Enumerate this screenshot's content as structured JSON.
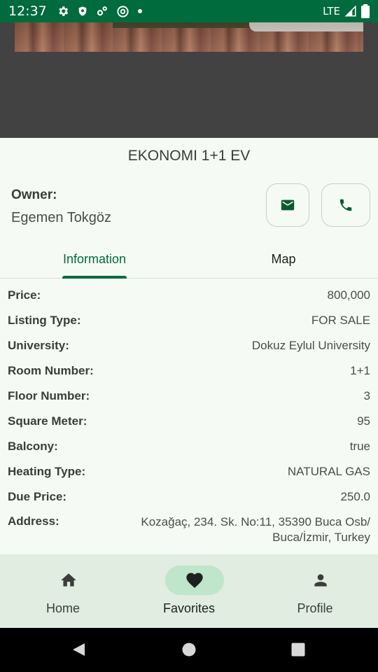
{
  "status_bar": {
    "time": "12:37",
    "network": "LTE"
  },
  "listing": {
    "title": "EKONOMI 1+1 EV",
    "owner_label": "Owner:",
    "owner_name": "Egemen Tokgöz"
  },
  "tabs": [
    {
      "label": "Information"
    },
    {
      "label": "Map"
    }
  ],
  "details": [
    {
      "label": "Price:",
      "value": "800,000"
    },
    {
      "label": "Listing Type:",
      "value": "FOR SALE"
    },
    {
      "label": "University:",
      "value": "Dokuz Eylul University"
    },
    {
      "label": "Room Number:",
      "value": "1+1"
    },
    {
      "label": "Floor Number:",
      "value": "3"
    },
    {
      "label": "Square Meter:",
      "value": "95"
    },
    {
      "label": "Balcony:",
      "value": "true"
    },
    {
      "label": "Heating Type:",
      "value": "NATURAL GAS"
    },
    {
      "label": "Due Price:",
      "value": "250.0"
    },
    {
      "label": "Address:",
      "value": "Kozağaç, 234. Sk. No:11, 35390 Buca Osb/ Buca/İzmir, Turkey"
    }
  ],
  "bottom_nav": [
    {
      "label": "Home",
      "icon": "home-icon"
    },
    {
      "label": "Favorites",
      "icon": "heart-icon"
    },
    {
      "label": "Profile",
      "icon": "person-icon"
    }
  ],
  "colors": {
    "primary": "#006b3c",
    "status_bar": "#006b3c",
    "nav_active_pill": "#bfe5cb",
    "nav_background": "#e0ede0"
  }
}
